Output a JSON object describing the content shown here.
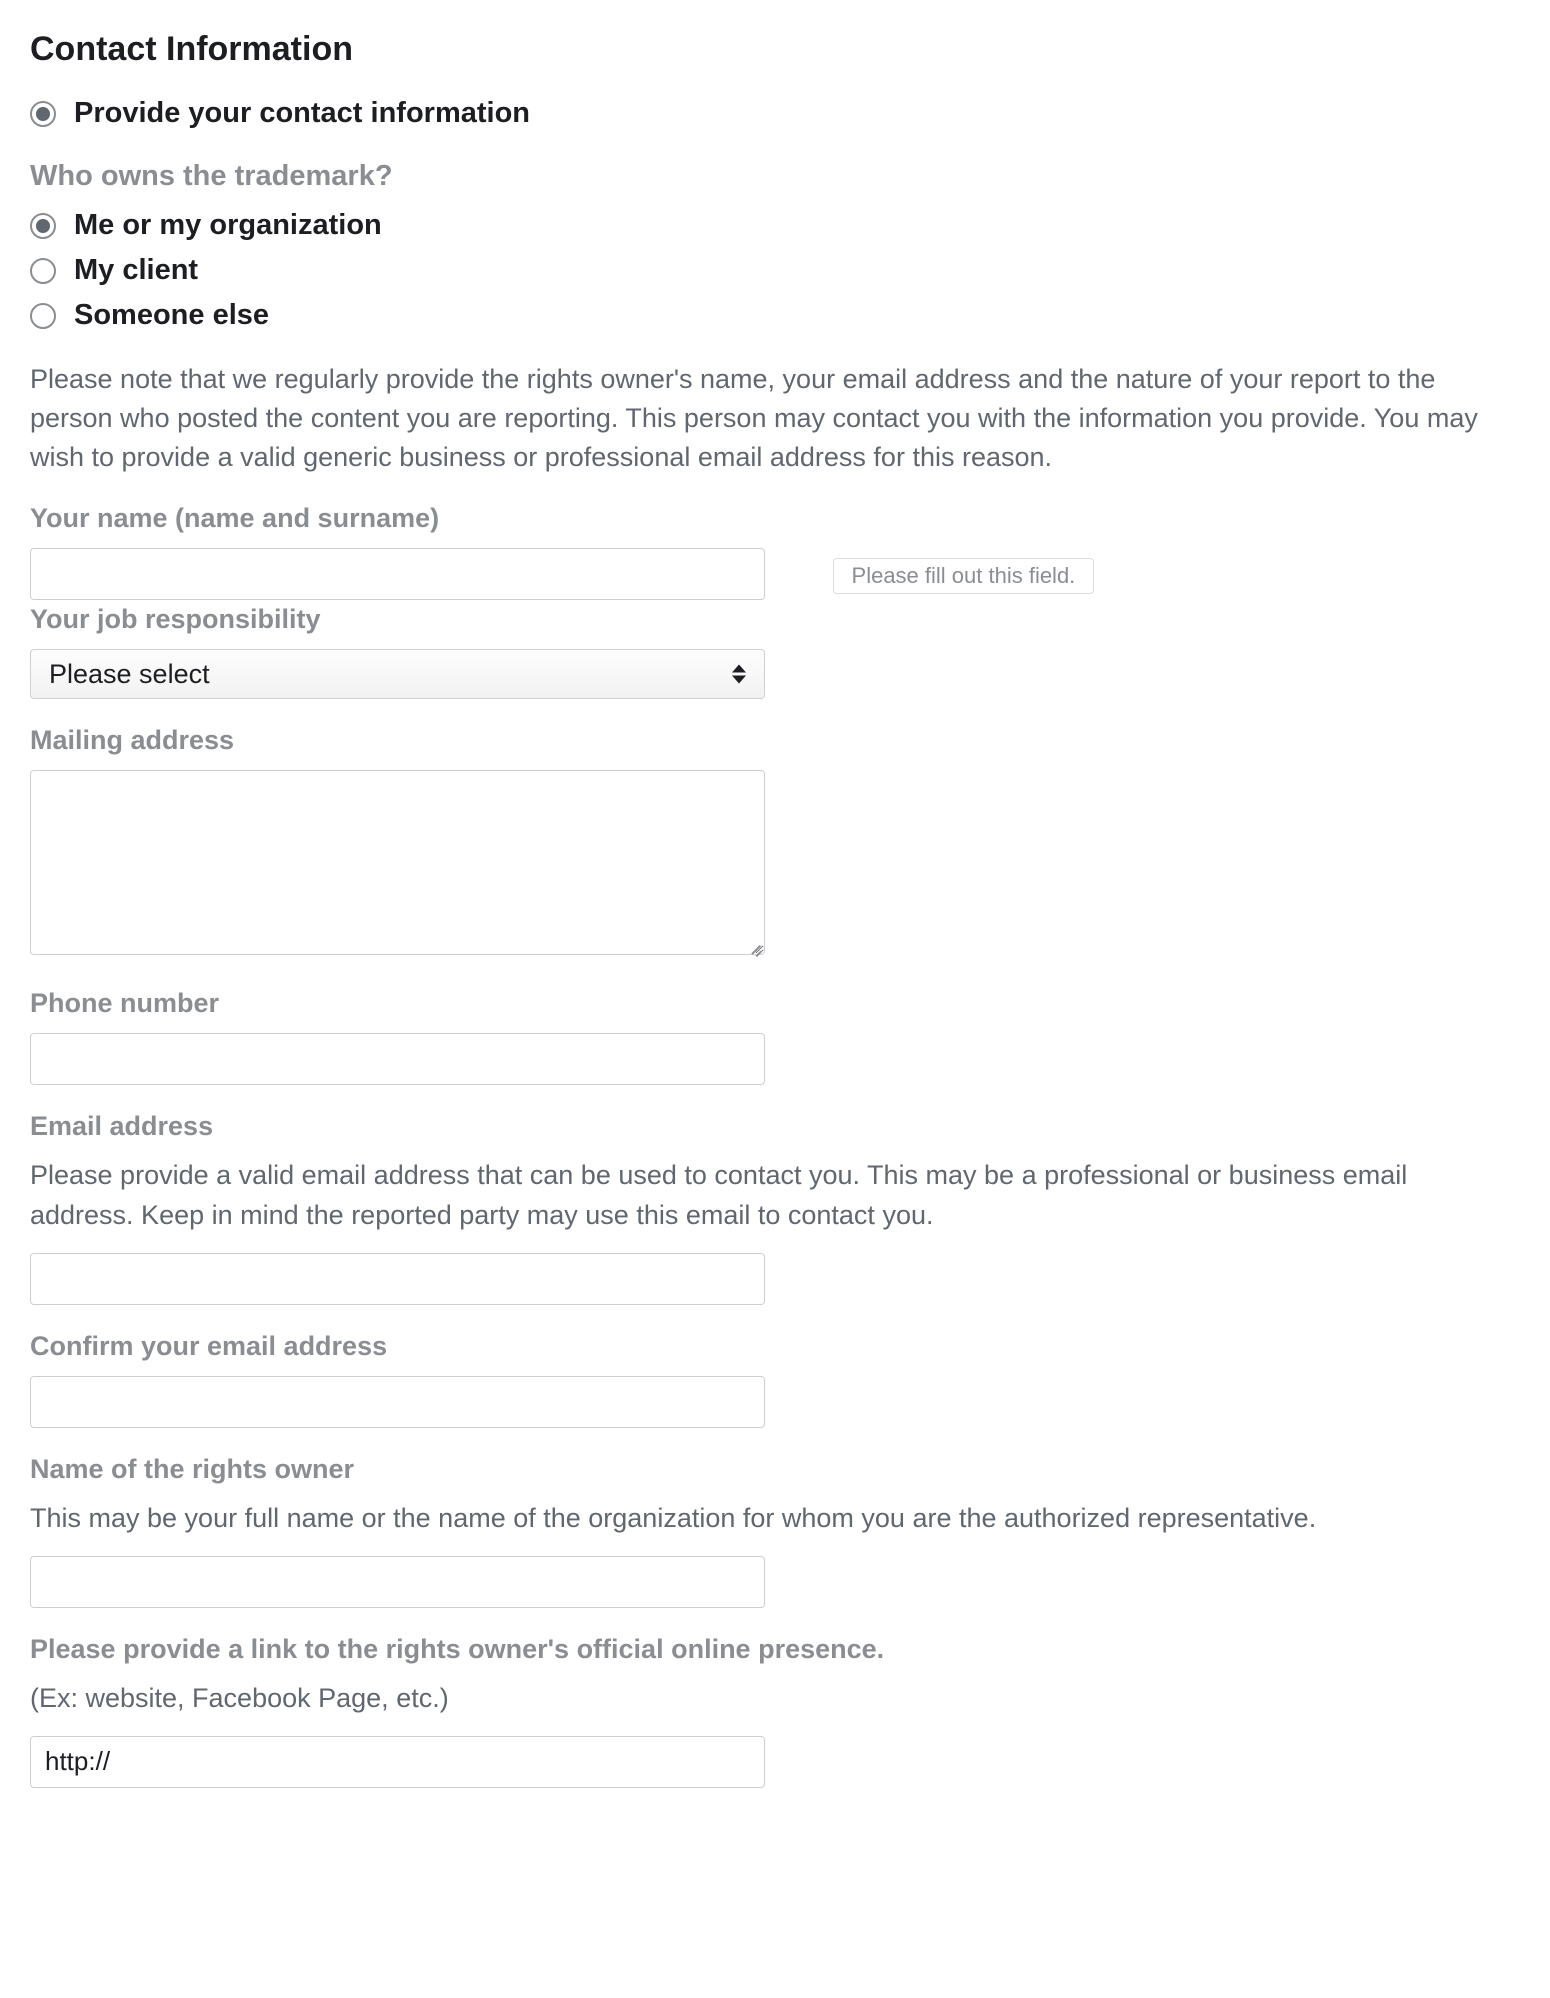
{
  "section_title": "Contact Information",
  "provide_contact": {
    "label": "Provide your contact information",
    "selected": true
  },
  "trademark_owner": {
    "question": "Who owns the trademark?",
    "options": [
      {
        "label": "Me or my organization",
        "selected": true
      },
      {
        "label": "My client",
        "selected": false
      },
      {
        "label": "Someone else",
        "selected": false
      }
    ]
  },
  "privacy_note": "Please note that we regularly provide the rights owner's name, your email address and the nature of your report to the person who posted the content you are reporting. This person may contact you with the information you provide. You may wish to provide a valid generic business or professional email address for this reason.",
  "your_name": {
    "label": "Your name (name and surname)",
    "value": "",
    "validation_tooltip": "Please fill out this field."
  },
  "job_responsibility": {
    "label": "Your job responsibility",
    "selected": "Please select"
  },
  "mailing_address": {
    "label": "Mailing address",
    "value": ""
  },
  "phone_number": {
    "label": "Phone number",
    "value": ""
  },
  "email_address": {
    "label": "Email address",
    "hint": "Please provide a valid email address that can be used to contact you. This may be a professional or business email address. Keep in mind the reported party may use this email to contact you.",
    "value": ""
  },
  "confirm_email": {
    "label": "Confirm your email address",
    "value": ""
  },
  "rights_owner_name": {
    "label": "Name of the rights owner",
    "hint": "This may be your full name or the name of the organization for whom you are the authorized representative.",
    "value": ""
  },
  "online_presence": {
    "label": "Please provide a link to the rights owner's official online presence.",
    "hint": "(Ex: website, Facebook Page, etc.)",
    "value": "http://"
  }
}
